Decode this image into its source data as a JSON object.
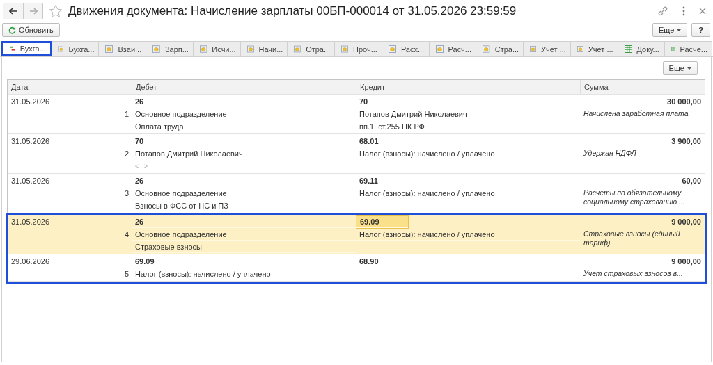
{
  "window": {
    "title": "Движения документа: Начисление зарплаты 00БП-000014 от 31.05.2026 23:59:59"
  },
  "toolbar": {
    "refresh": "Обновить",
    "more": "Еще",
    "help": "?"
  },
  "tabs": [
    {
      "label": "Бухга...",
      "kind": "dtkt",
      "selected": true,
      "framed": true
    },
    {
      "label": "Бухга...",
      "kind": "register",
      "selected": false,
      "framed": false
    },
    {
      "label": "Взаи...",
      "kind": "register",
      "selected": false,
      "framed": false
    },
    {
      "label": "Зарп...",
      "kind": "register",
      "selected": false,
      "framed": false
    },
    {
      "label": "Исчи...",
      "kind": "register",
      "selected": false,
      "framed": false
    },
    {
      "label": "Начи...",
      "kind": "register",
      "selected": false,
      "framed": false
    },
    {
      "label": "Отра...",
      "kind": "register",
      "selected": false,
      "framed": false
    },
    {
      "label": "Проч...",
      "kind": "register",
      "selected": false,
      "framed": false
    },
    {
      "label": "Расх...",
      "kind": "register",
      "selected": false,
      "framed": false
    },
    {
      "label": "Расч...",
      "kind": "register",
      "selected": false,
      "framed": false
    },
    {
      "label": "Стра...",
      "kind": "register",
      "selected": false,
      "framed": false
    },
    {
      "label": "Учет ...",
      "kind": "register",
      "selected": false,
      "framed": false
    },
    {
      "label": "Учет ...",
      "kind": "register",
      "selected": false,
      "framed": false
    },
    {
      "label": "Доку...",
      "kind": "table",
      "selected": false,
      "framed": false
    },
    {
      "label": "Расче...",
      "kind": "table",
      "selected": false,
      "framed": false
    }
  ],
  "panel": {
    "more": "Еще"
  },
  "table": {
    "columns": [
      "Дата",
      "Дебет",
      "Кредит",
      "Сумма"
    ],
    "rows": [
      {
        "date": "31.05.2026",
        "number": "1",
        "debit": [
          "26",
          "Основное подразделение",
          "Оплата труда"
        ],
        "credit": [
          "70",
          "Потапов Дмитрий Николаевич",
          "пп.1, ст.255 НК РФ"
        ],
        "amount": "30 000,00",
        "comment": "Начислена заработная плата",
        "selected": false,
        "framed": false
      },
      {
        "date": "31.05.2026",
        "number": "2",
        "debit": [
          "70",
          "Потапов Дмитрий Николаевич",
          "<...>"
        ],
        "credit": [
          "68.01",
          "Налог (взносы): начислено / уплачено"
        ],
        "amount": "3 900,00",
        "comment": "Удержан НДФЛ",
        "selected": false,
        "framed": false
      },
      {
        "date": "31.05.2026",
        "number": "3",
        "debit": [
          "26",
          "Основное подразделение",
          "Взносы в ФСС от НС и ПЗ"
        ],
        "credit": [
          "69.11",
          "Налог (взносы): начислено / уплачено"
        ],
        "amount": "60,00",
        "comment": "Расчеты по обязательному социальному страхованию ...",
        "selected": false,
        "framed": false
      },
      {
        "date": "31.05.2026",
        "number": "4",
        "debit": [
          "26",
          "Основное подразделение",
          "Страховые взносы"
        ],
        "credit": [
          "69.09",
          "Налог (взносы): начислено / уплачено"
        ],
        "amount": "9 000,00",
        "comment": "Страховые взносы (единый тариф)",
        "selected": true,
        "framed": true
      },
      {
        "date": "29.06.2026",
        "number": "5",
        "debit": [
          "69.09",
          "Налог (взносы): начислено / уплачено"
        ],
        "credit": [
          "68.90"
        ],
        "amount": "9 000,00",
        "comment": "Учет страховых взносов в...",
        "selected": false,
        "framed": true
      }
    ]
  }
}
